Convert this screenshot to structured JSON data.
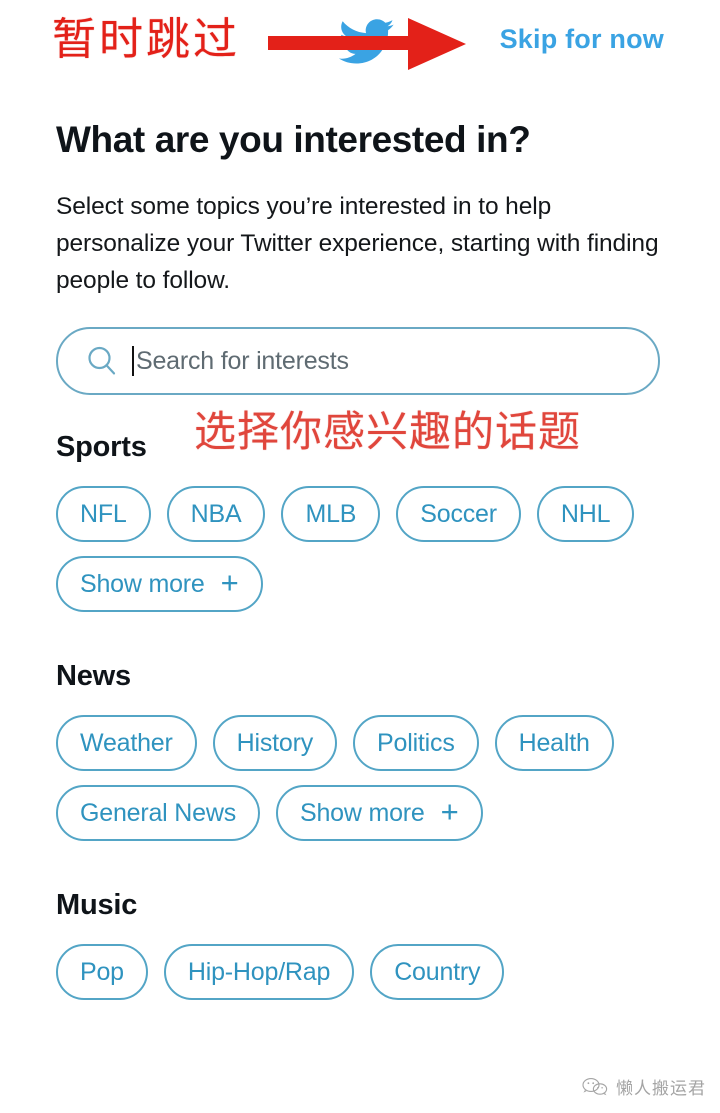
{
  "annotations": {
    "skip_cn": "暂时跳过",
    "topics_cn": "选择你感兴趣的话题",
    "arrow_color": "#e32119",
    "cn_text_color": "#e32119"
  },
  "topbar": {
    "skip_label": "Skip for now",
    "skip_color": "#3aa3e3",
    "bird_color": "#3aa3e3"
  },
  "main": {
    "title": "What are you interested in?",
    "description": "Select some topics you’re interested in to help personalize your Twitter experience, starting with finding people to follow."
  },
  "search": {
    "placeholder": "Search for interests",
    "value": "",
    "icon": "search-icon",
    "border_color": "#6aa9c4"
  },
  "chip_style": {
    "border_color": "#53a5c6",
    "text_color": "#2f93bf"
  },
  "sections": [
    {
      "heading": "Sports",
      "chips": [
        {
          "label": "NFL",
          "plus": false
        },
        {
          "label": "NBA",
          "plus": false
        },
        {
          "label": "MLB",
          "plus": false
        },
        {
          "label": "Soccer",
          "plus": false
        },
        {
          "label": "NHL",
          "plus": false
        },
        {
          "label": "Show more",
          "plus": true
        }
      ]
    },
    {
      "heading": "News",
      "chips": [
        {
          "label": "Weather",
          "plus": false
        },
        {
          "label": "History",
          "plus": false
        },
        {
          "label": "Politics",
          "plus": false
        },
        {
          "label": "Health",
          "plus": false
        },
        {
          "label": "General News",
          "plus": false
        },
        {
          "label": "Show more",
          "plus": true
        }
      ]
    },
    {
      "heading": "Music",
      "chips": [
        {
          "label": "Pop",
          "plus": false
        },
        {
          "label": "Hip-Hop/Rap",
          "plus": false
        },
        {
          "label": "Country",
          "plus": false
        }
      ]
    }
  ],
  "watermark": {
    "text": "懒人搬运君",
    "icon": "wechat-icon"
  },
  "plus_glyph": "+"
}
